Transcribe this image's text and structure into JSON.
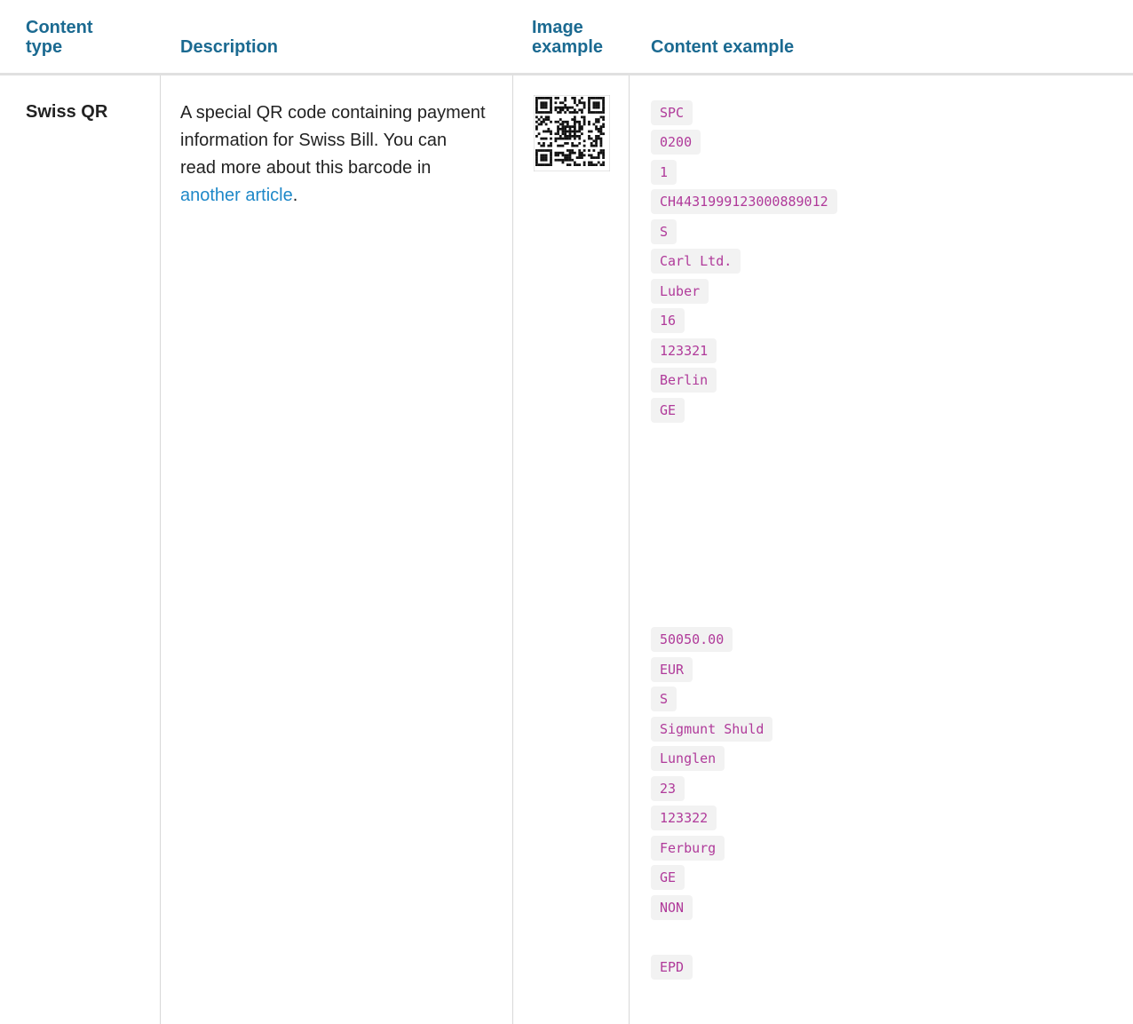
{
  "headers": {
    "content_type": "Content type",
    "description": "Description",
    "image_example": "Image example",
    "content_example": "Content example"
  },
  "row": {
    "content_type": "Swiss QR",
    "description_prefix": "A special QR code containing payment information for Swiss Bill. You can read more about this barcode in ",
    "description_link": "another article",
    "description_suffix": ".",
    "image_icon": "qr-code-icon",
    "content_lines": [
      "SPC",
      "0200",
      "1",
      "CH4431999123000889012",
      "S",
      "Carl Ltd.",
      "Luber",
      "16",
      "123321",
      "Berlin",
      "GE",
      "50050.00",
      "EUR",
      "S",
      "Sigmunt Shuld",
      "Lunglen",
      "23",
      "123322",
      "Ferburg",
      "GE",
      "NON",
      "EPD"
    ]
  },
  "colors": {
    "header_text": "#1b6a91",
    "link": "#1e88c8",
    "code_text": "#b03a9a",
    "code_bg": "#f2f2f2"
  }
}
